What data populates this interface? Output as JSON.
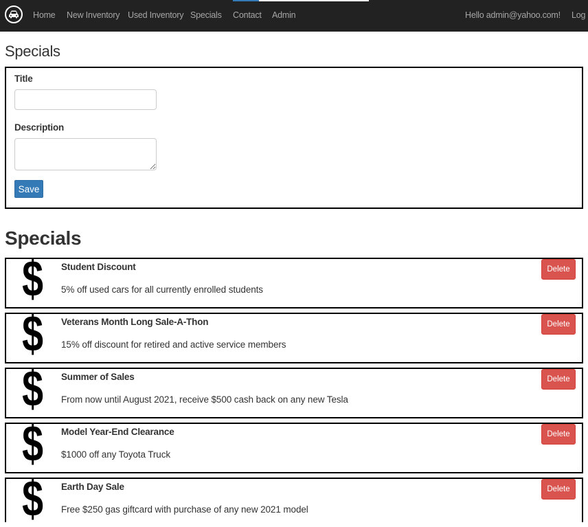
{
  "navbar": {
    "logo_icon": "car-icon",
    "links": [
      "Home",
      "New Inventory",
      "Used Inventory",
      "Specials",
      "Contact",
      "Admin"
    ],
    "greeting": "Hello admin@yahoo.com!",
    "logout": "Log o"
  },
  "form": {
    "heading": "Specials",
    "title_label": "Title",
    "title_value": "",
    "description_label": "Description",
    "description_value": "",
    "save_label": "Save"
  },
  "list": {
    "heading": "Specials",
    "item_icon": "dollar-icon",
    "items": [
      {
        "icon": "$",
        "title": "Student Discount",
        "description": "5% off used cars for all currently enrolled students",
        "delete_label": "Delete"
      },
      {
        "icon": "$",
        "title": "Veterans Month Long Sale-A-Thon",
        "description": "15% off discount for retired and active service members",
        "delete_label": "Delete"
      },
      {
        "icon": "$",
        "title": "Summer of Sales",
        "description": "From now until August 2021, receive $500 cash back on any new Tesla",
        "delete_label": "Delete"
      },
      {
        "icon": "$",
        "title": "Model Year-End Clearance",
        "description": "$1000 off any Toyota Truck",
        "delete_label": "Delete"
      },
      {
        "icon": "$",
        "title": "Earth Day Sale",
        "description": "Free $250 gas giftcard with purchase of any new 2021 model",
        "delete_label": "Delete"
      }
    ]
  },
  "colors": {
    "navbar_bg": "#222222",
    "primary": "#337ab7",
    "danger": "#d9534f"
  }
}
